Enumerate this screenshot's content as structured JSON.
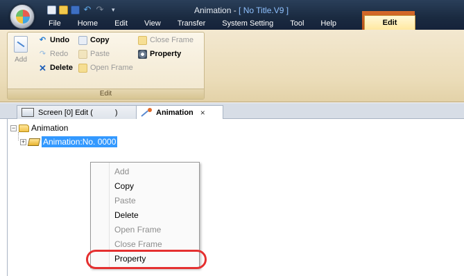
{
  "window": {
    "title_prefix": "Animation - ",
    "title_doc": "[ No Title.V9 ]"
  },
  "context_tab_group": "Animation",
  "menu": {
    "items": [
      "File",
      "Home",
      "Edit",
      "View",
      "Transfer",
      "System Setting",
      "Tool",
      "Help"
    ],
    "active": "Edit"
  },
  "ribbon": {
    "group_label": "Edit",
    "add_label": "Add",
    "undo": "Undo",
    "redo": "Redo",
    "delete": "Delete",
    "copy": "Copy",
    "paste": "Paste",
    "open_frame": "Open Frame",
    "close_frame": "Close Frame",
    "property": "Property"
  },
  "tabs": {
    "screen": "Screen [0] Edit (",
    "screen_suffix": ")",
    "animation": "Animation",
    "close": "×"
  },
  "tree": {
    "root": "Animation",
    "child": "Animation:No. 0000"
  },
  "context_menu": {
    "items": [
      {
        "label": "Add",
        "enabled": false
      },
      {
        "label": "Copy",
        "enabled": true
      },
      {
        "label": "Paste",
        "enabled": false
      },
      {
        "label": "Delete",
        "enabled": true
      },
      {
        "label": "Open Frame",
        "enabled": false
      },
      {
        "label": "Close Frame",
        "enabled": false
      },
      {
        "label": "Property",
        "enabled": true
      }
    ],
    "highlighted": "Property",
    "highlight_color": "#e53030"
  }
}
